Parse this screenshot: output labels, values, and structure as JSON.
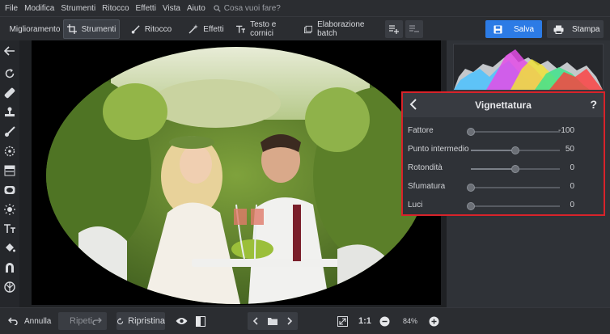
{
  "menu": {
    "items": [
      "File",
      "Modifica",
      "Strumenti",
      "Ritocco",
      "Effetti",
      "Vista",
      "Aiuto"
    ],
    "search_placeholder": "Cosa vuoi fare?"
  },
  "toolbar": {
    "tabs": [
      {
        "label": "Miglioramento",
        "icon": "sliders-icon",
        "active": false
      },
      {
        "label": "Strumenti",
        "icon": "crop-icon",
        "active": true
      },
      {
        "label": "Ritocco",
        "icon": "brush-icon",
        "active": false
      },
      {
        "label": "Effetti",
        "icon": "magic-wand-icon",
        "active": false
      },
      {
        "label": "Testo e cornici",
        "icon": "text-icon",
        "active": false
      },
      {
        "label": "Elaborazione batch",
        "icon": "batch-icon",
        "active": false
      }
    ],
    "save_label": "Salva",
    "print_label": "Stampa",
    "save_color": "#2c7be5"
  },
  "vignette": {
    "title": "Vignettatura",
    "help": "?",
    "rows": [
      {
        "label": "Fattore",
        "value": "-100",
        "position": 0.0
      },
      {
        "label": "Punto intermedio",
        "value": "50",
        "position": 0.5
      },
      {
        "label": "Rotondità",
        "value": "0",
        "position": 0.5
      },
      {
        "label": "Sfumatura",
        "value": "0",
        "position": 0.0
      },
      {
        "label": "Luci",
        "value": "0",
        "position": 0.0
      }
    ],
    "highlight_color": "#d8232a"
  },
  "bottom": {
    "undo_label": "Annulla",
    "redo_label": "Ripeti",
    "reset_label": "Ripristina",
    "zoom_fit_label": "1:1",
    "zoom_value": "84%"
  }
}
